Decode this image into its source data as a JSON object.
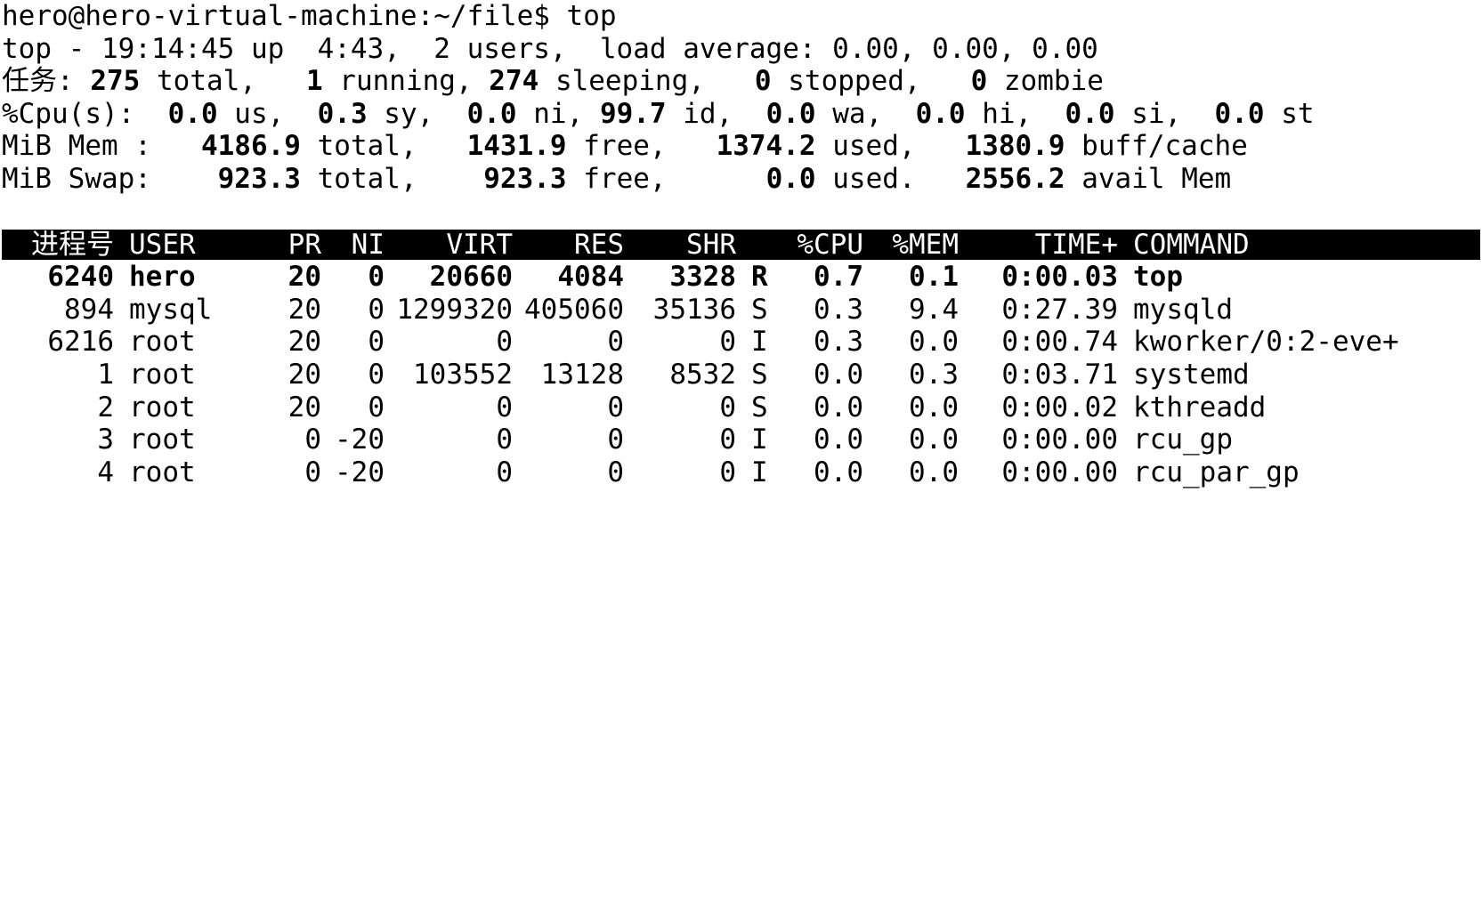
{
  "terminal": {
    "prompt": "hero@hero-virtual-machine:~/file$ top",
    "summary": {
      "uptime": "top - 19:14:45 up  4:43,  2 users,  load average: 0.00, 0.00, 0.00",
      "tasks": {
        "label": "任务: ",
        "total": "275",
        "total_label": " total,   ",
        "running": "1",
        "running_label": " running, ",
        "sleeping": "274",
        "sleeping_label": " sleeping,   ",
        "stopped": "0",
        "stopped_label": " stopped,   ",
        "zombie": "0",
        "zombie_label": " zombie"
      },
      "cpu": {
        "label": "%Cpu(s):  ",
        "us": "0.0",
        "us_label": " us,  ",
        "sy": "0.3",
        "sy_label": " sy,  ",
        "ni": "0.0",
        "ni_label": " ni, ",
        "id": "99.7",
        "id_label": " id,  ",
        "wa": "0.0",
        "wa_label": " wa,  ",
        "hi": "0.0",
        "hi_label": " hi,  ",
        "si": "0.0",
        "si_label": " si,  ",
        "st": "0.0",
        "st_label": " st"
      },
      "mem": {
        "label": "MiB Mem :   ",
        "total": "4186.9",
        "total_label": " total,   ",
        "free": "1431.9",
        "free_label": " free,   ",
        "used": "1374.2",
        "used_label": " used,   ",
        "buff": "1380.9",
        "buff_label": " buff/cache"
      },
      "swap": {
        "label": "MiB Swap:    ",
        "total": "923.3",
        "total_label": " total,    ",
        "free": "923.3",
        "free_label": " free,      ",
        "used": "0.0",
        "used_label": " used.   ",
        "avail": "2556.2",
        "avail_label": " avail Mem"
      }
    },
    "table": {
      "headers": {
        "pid": "进程号",
        "user": "USER",
        "pr": "PR",
        "ni": "NI",
        "virt": "VIRT",
        "res": "RES",
        "shr": "SHR",
        "s": "",
        "cpu": "%CPU",
        "mem": "%MEM",
        "time": "TIME+",
        "command": "COMMAND"
      },
      "rows": [
        {
          "pid": "6240",
          "user": "hero",
          "pr": "20",
          "ni": "0",
          "virt": "20660",
          "res": "4084",
          "shr": "3328",
          "s": "R",
          "cpu": "0.7",
          "mem": "0.1",
          "time": "0:00.03",
          "command": "top"
        },
        {
          "pid": "894",
          "user": "mysql",
          "pr": "20",
          "ni": "0",
          "virt": "1299320",
          "res": "405060",
          "shr": "35136",
          "s": "S",
          "cpu": "0.3",
          "mem": "9.4",
          "time": "0:27.39",
          "command": "mysqld"
        },
        {
          "pid": "6216",
          "user": "root",
          "pr": "20",
          "ni": "0",
          "virt": "0",
          "res": "0",
          "shr": "0",
          "s": "I",
          "cpu": "0.3",
          "mem": "0.0",
          "time": "0:00.74",
          "command": "kworker/0:2-eve+"
        },
        {
          "pid": "1",
          "user": "root",
          "pr": "20",
          "ni": "0",
          "virt": "103552",
          "res": "13128",
          "shr": "8532",
          "s": "S",
          "cpu": "0.0",
          "mem": "0.3",
          "time": "0:03.71",
          "command": "systemd"
        },
        {
          "pid": "2",
          "user": "root",
          "pr": "20",
          "ni": "0",
          "virt": "0",
          "res": "0",
          "shr": "0",
          "s": "S",
          "cpu": "0.0",
          "mem": "0.0",
          "time": "0:00.02",
          "command": "kthreadd"
        },
        {
          "pid": "3",
          "user": "root",
          "pr": "0",
          "ni": "-20",
          "virt": "0",
          "res": "0",
          "shr": "0",
          "s": "I",
          "cpu": "0.0",
          "mem": "0.0",
          "time": "0:00.00",
          "command": "rcu_gp"
        },
        {
          "pid": "4",
          "user": "root",
          "pr": "0",
          "ni": "-20",
          "virt": "0",
          "res": "0",
          "shr": "0",
          "s": "I",
          "cpu": "0.0",
          "mem": "0.0",
          "time": "0:00.00",
          "command": "rcu_par_gp"
        }
      ]
    }
  }
}
